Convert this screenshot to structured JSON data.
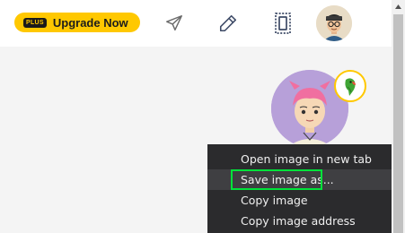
{
  "header": {
    "upgrade": {
      "badge": "PLUS",
      "label": "Upgrade Now",
      "color": "#ffc800"
    },
    "icons": [
      "send-icon",
      "pencil-icon",
      "stamp-icon"
    ],
    "avatar": "user-avatar"
  },
  "profile": {
    "avatar": "profile-avatar",
    "badge_icon": "parrot-icon"
  },
  "context_menu": {
    "items": [
      {
        "label": "Open image in new tab"
      },
      {
        "label": "Save image as..."
      },
      {
        "label": "Copy image"
      },
      {
        "label": "Copy image address"
      }
    ],
    "hovered_index": 1,
    "highlight_color": "#00e33a"
  }
}
